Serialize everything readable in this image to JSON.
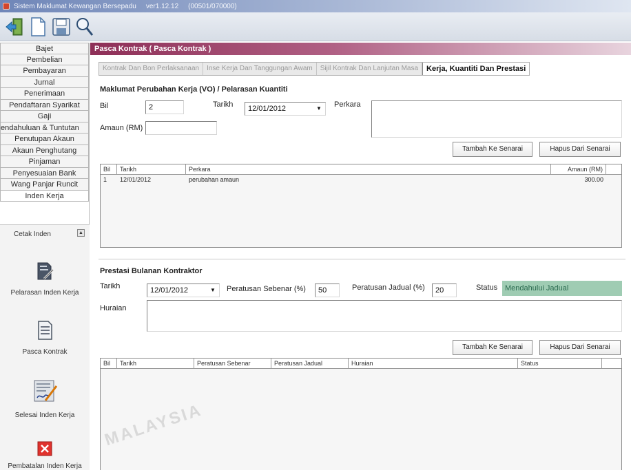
{
  "window": {
    "title": "Sistem Maklumat Kewangan Bersepadu",
    "version": "ver1.12.12",
    "code": "(00501/070000)"
  },
  "toolbar": {
    "icons": [
      "exit-icon",
      "new-document-icon",
      "save-icon",
      "search-icon"
    ]
  },
  "sidebar": {
    "items": [
      {
        "label": "Bajet"
      },
      {
        "label": "Pembelian"
      },
      {
        "label": "Pembayaran"
      },
      {
        "label": "Jurnal"
      },
      {
        "label": "Penerimaan"
      },
      {
        "label": "Pendaftaran Syarikat"
      },
      {
        "label": "Gaji"
      },
      {
        "label": "endahuluan & Tuntutan"
      },
      {
        "label": "Penutupan Akaun"
      },
      {
        "label": "Akaun Penghutang"
      },
      {
        "label": "Pinjaman"
      },
      {
        "label": "Penyesuaian Bank"
      },
      {
        "label": "Wang Panjar Runcit"
      },
      {
        "label": "Inden Kerja"
      }
    ],
    "sub_header": "Cetak Inden",
    "tools": [
      {
        "label": "Pelarasan Inden Kerja",
        "icon": "pencil-document-icon"
      },
      {
        "label": "Pasca Kontrak",
        "icon": "document-icon"
      },
      {
        "label": "Selesai Inden Kerja",
        "icon": "signed-document-icon"
      },
      {
        "label": "Pembatalan Inden Kerja",
        "icon": "cancel-x-icon"
      }
    ]
  },
  "main": {
    "header": "Pasca Kontrak ( Pasca Kontrak )",
    "tabs": [
      {
        "label": "Kontrak Dan Bon Perlaksanaan"
      },
      {
        "label": "Inse Kerja Dan Tanggungan Awam"
      },
      {
        "label": "Sijil Kontrak Dan Lanjutan Masa"
      },
      {
        "label": "Kerja, Kuantiti Dan Prestasi"
      }
    ],
    "vo_section": {
      "title": "Maklumat Perubahan Kerja (VO) / Pelarasan Kuantiti",
      "bil_label": "Bil",
      "bil_value": "2",
      "tarikh_label": "Tarikh",
      "tarikh_value": "12/01/2012",
      "perkara_label": "Perkara",
      "amaun_label": "Amaun (RM)",
      "amaun_value": "",
      "add_button": "Tambah Ke Senarai",
      "remove_button": "Hapus Dari Senarai",
      "table": {
        "columns": [
          "Bil",
          "Tarikh",
          "Perkara",
          "Amaun (RM)"
        ],
        "rows": [
          {
            "bil": "1",
            "tarikh": "12/01/2012",
            "perkara": "perubahan amaun",
            "amaun": "300.00"
          }
        ]
      }
    },
    "prestasi_section": {
      "title": "Prestasi Bulanan Kontraktor",
      "tarikh_label": "Tarikh",
      "tarikh_value": "12/01/2012",
      "sebenar_label": "Peratusan Sebenar (%)",
      "sebenar_value": "50",
      "jadual_label": "Peratusan Jadual (%)",
      "jadual_value": "20",
      "status_label": "Status",
      "status_value": "Mendahului Jadual",
      "huraian_label": "Huraian",
      "add_button": "Tambah Ke Senarai",
      "remove_button": "Hapus Dari Senarai",
      "table": {
        "columns": [
          "Bil",
          "Tarikh",
          "Peratusan Sebenar",
          "Peratusan Jadual",
          "Huraian",
          "Status"
        ]
      }
    },
    "watermark": "MALAYSIA"
  },
  "colors": {
    "header_bar": "#8e2f57",
    "status_bg": "#9fccb3",
    "status_text": "#2a6a4f"
  }
}
